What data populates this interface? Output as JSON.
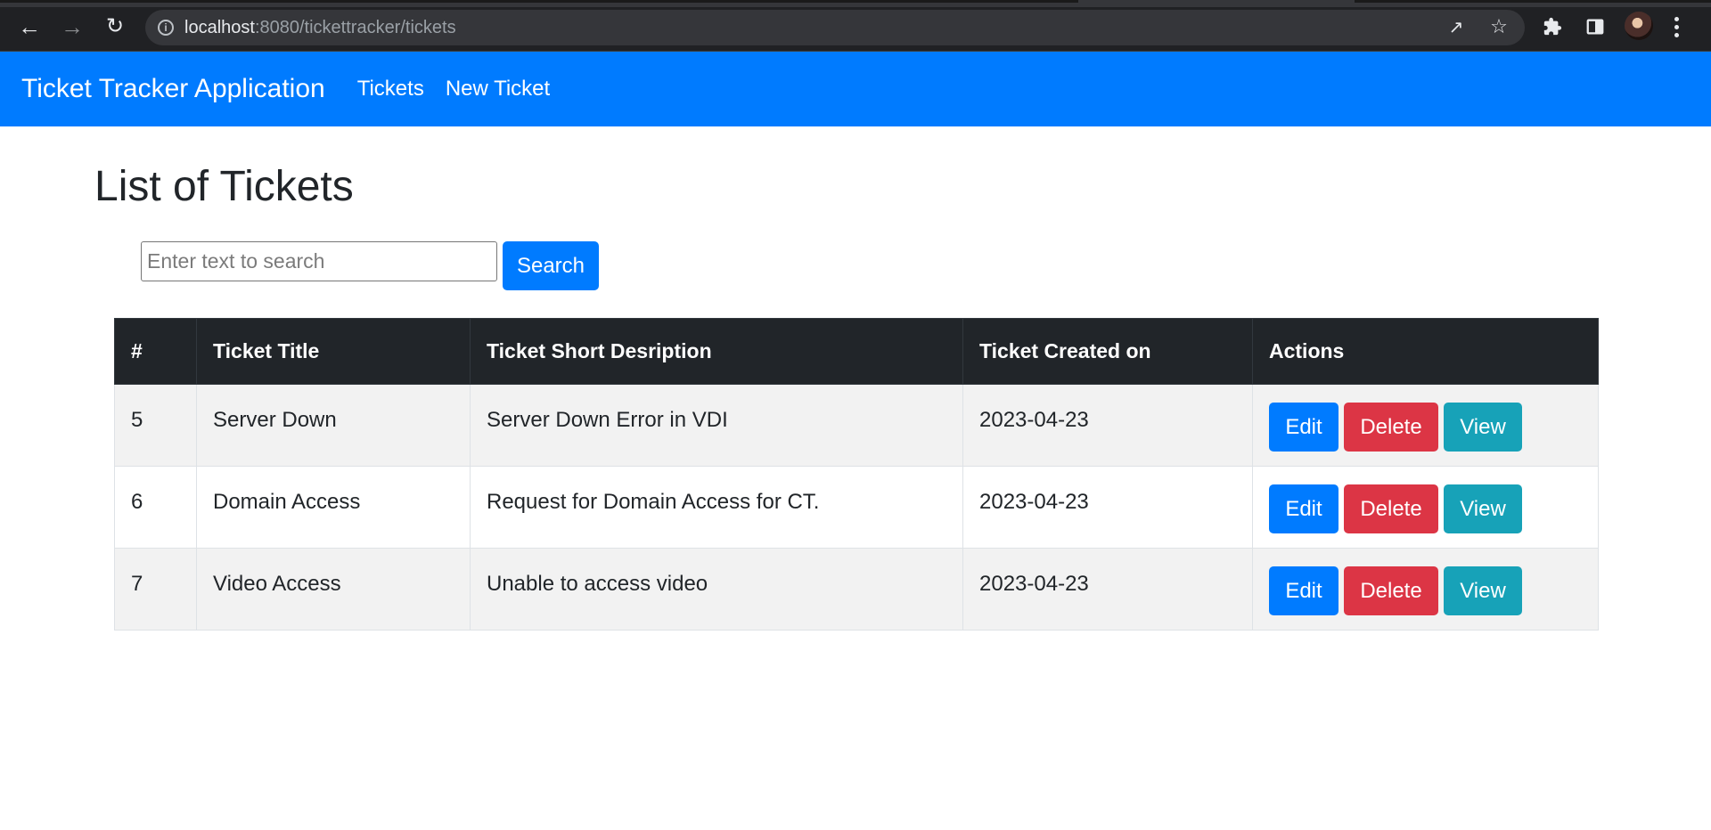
{
  "browser": {
    "url_host": "localhost",
    "url_path": ":8080/tickettracker/tickets"
  },
  "navbar": {
    "brand": "Ticket Tracker Application",
    "links": [
      "Tickets",
      "New Ticket"
    ]
  },
  "page": {
    "title": "List of Tickets"
  },
  "search": {
    "placeholder": "Enter text to search",
    "value": "",
    "button_label": "Search"
  },
  "table": {
    "headers": [
      "#",
      "Ticket Title",
      "Ticket Short Desription",
      "Ticket Created on",
      "Actions"
    ],
    "rows": [
      {
        "id": "5",
        "title": "Server Down",
        "description": "Server Down Error in VDI",
        "created": "2023-04-23"
      },
      {
        "id": "6",
        "title": "Domain Access",
        "description": "Request for Domain Access for CT.",
        "created": "2023-04-23"
      },
      {
        "id": "7",
        "title": "Video Access",
        "description": "Unable to access video",
        "created": "2023-04-23"
      }
    ],
    "actions": {
      "edit": "Edit",
      "delete": "Delete",
      "view": "View"
    }
  },
  "colors": {
    "primary": "#007bff",
    "danger": "#dc3545",
    "info": "#17a2b8",
    "dark": "#212529"
  }
}
